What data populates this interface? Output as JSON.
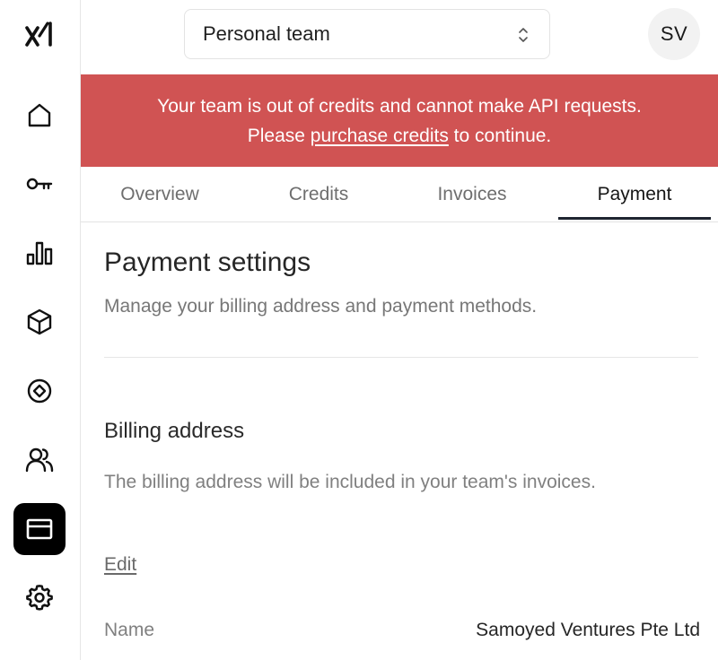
{
  "sidebar": {
    "logo": "xAI",
    "items": [
      {
        "icon": "home-icon",
        "active": false
      },
      {
        "icon": "key-icon",
        "active": false
      },
      {
        "icon": "bar-chart-icon",
        "active": false
      },
      {
        "icon": "cube-icon",
        "active": false
      },
      {
        "icon": "target-icon",
        "active": false
      },
      {
        "icon": "users-icon",
        "active": false
      },
      {
        "icon": "billing-icon",
        "active": true
      },
      {
        "icon": "gear-icon",
        "active": false
      }
    ]
  },
  "header": {
    "team_select": "Personal team",
    "avatar_initials": "SV"
  },
  "banner": {
    "line1": "Your team is out of credits and cannot make API requests.",
    "line2_prefix": "Please ",
    "link": "purchase credits",
    "line2_suffix": " to continue.",
    "color": "#d05353"
  },
  "tabs": [
    {
      "label": "Overview",
      "active": false
    },
    {
      "label": "Credits",
      "active": false
    },
    {
      "label": "Invoices",
      "active": false
    },
    {
      "label": "Payment",
      "active": true
    }
  ],
  "payment": {
    "title": "Payment settings",
    "subtitle": "Manage your billing address and payment methods.",
    "billing": {
      "title": "Billing address",
      "description": "The billing address will be included in your team's invoices.",
      "edit_label": "Edit",
      "fields": [
        {
          "label": "Name",
          "value": "Samoyed Ventures Pte Ltd"
        }
      ]
    }
  }
}
